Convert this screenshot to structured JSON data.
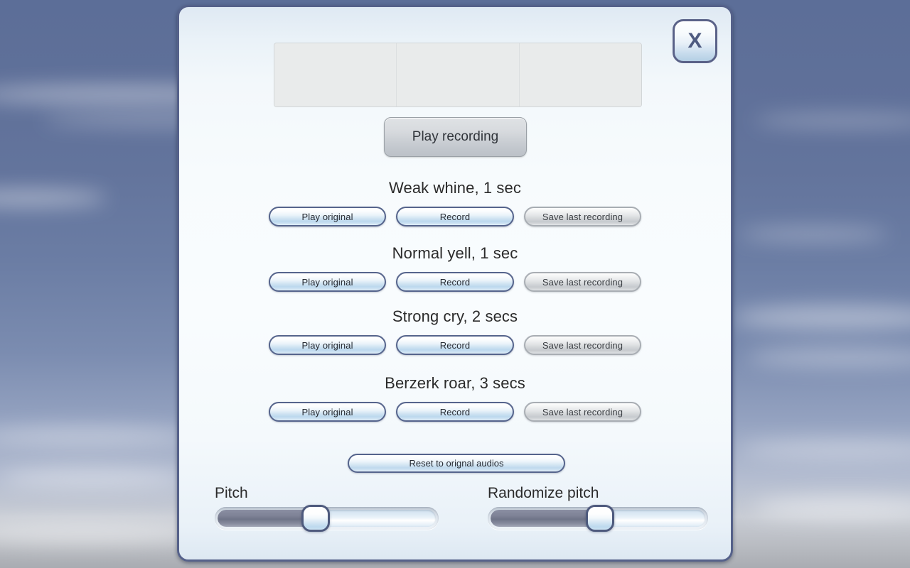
{
  "dialog": {
    "close_label": "X"
  },
  "waveform": {
    "slots": [
      "",
      "",
      ""
    ]
  },
  "play_recording": {
    "label": "Play recording"
  },
  "sounds": [
    {
      "title": "Weak whine, 1 sec",
      "play_label": "Play original",
      "record_label": "Record",
      "save_label": "Save last recording"
    },
    {
      "title": "Normal yell, 1 sec",
      "play_label": "Play original",
      "record_label": "Record",
      "save_label": "Save last recording"
    },
    {
      "title": "Strong cry, 2 secs",
      "play_label": "Play original",
      "record_label": "Record",
      "save_label": "Save last recording"
    },
    {
      "title": "Berzerk roar, 3 secs",
      "play_label": "Play original",
      "record_label": "Record",
      "save_label": "Save last recording"
    }
  ],
  "reset": {
    "label": "Reset to orignal audios"
  },
  "sliders": [
    {
      "label": "Pitch",
      "value_percent": 45
    },
    {
      "label": "Randomize pitch",
      "value_percent": 51
    }
  ],
  "colors": {
    "dialog_border": "#55618a",
    "button_blue_border": "#55648c",
    "button_gray_border": "#a8adb3",
    "text": "#2b2b2b",
    "slider_fill": "#7e8296",
    "sky_top": "#5c6e98",
    "sky_bottom": "#a9acb2"
  }
}
